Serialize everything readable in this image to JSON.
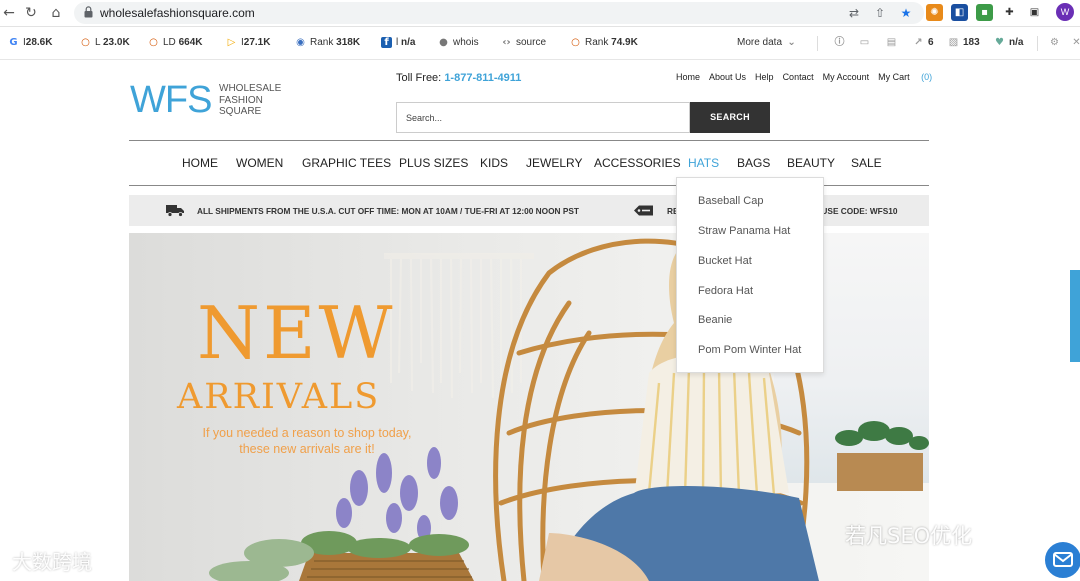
{
  "browser": {
    "url": "wholesalefashionsquare.com",
    "profile_initial": "W"
  },
  "seo_toolbar": {
    "items": [
      {
        "icon": "google-icon",
        "prefix": "I",
        "value": "28.6K"
      },
      {
        "icon": "circle-icon",
        "prefix": "L",
        "value": "23.0K"
      },
      {
        "icon": "circle-icon",
        "prefix": "LD",
        "value": "664K"
      },
      {
        "icon": "bing-icon",
        "prefix": "I",
        "value": "27.1K"
      },
      {
        "icon": "semrush-icon",
        "prefix": "Rank",
        "value": "318K"
      },
      {
        "icon": "facebook-icon",
        "prefix": "l",
        "value": "n/a"
      },
      {
        "icon": "person-icon",
        "prefix": "",
        "value": "whois"
      },
      {
        "icon": "code-icon",
        "prefix": "",
        "value": "source"
      },
      {
        "icon": "circle-icon",
        "prefix": "Rank",
        "value": "74.9K"
      }
    ],
    "more_data": "More data",
    "right_items": [
      {
        "icon": "info-icon",
        "value": ""
      },
      {
        "icon": "monitor-icon",
        "value": ""
      },
      {
        "icon": "page-icon",
        "value": ""
      },
      {
        "icon": "external-link-icon",
        "value": "6"
      },
      {
        "icon": "image-icon",
        "value": "183"
      },
      {
        "icon": "heart-icon",
        "value": "n/a"
      }
    ]
  },
  "header": {
    "logo_mark": "WFS",
    "logo_line1": "WHOLESALE",
    "logo_line2": "FASHION",
    "logo_line3": "SQUARE",
    "tollfree_label": "Toll Free:",
    "tollfree_number": "1-877-811-4911",
    "links": [
      "Home",
      "About Us",
      "Help",
      "Contact",
      "My Account",
      "My Cart"
    ],
    "cart_count": "(0)",
    "search_placeholder": "Search...",
    "search_button": "SEARCH"
  },
  "menu": {
    "items": [
      "HOME",
      "WOMEN",
      "GRAPHIC TEES",
      "PLUS SIZES",
      "KIDS",
      "JEWELRY",
      "ACCESSORIES",
      "HATS",
      "BAGS",
      "BEAUTY",
      "SALE"
    ],
    "active": "HATS"
  },
  "shipping": {
    "text": "ALL SHIPMENTS FROM THE U.S.A. CUT OFF TIME: MON AT 10AM / TUE-FRI AT 12:00 NOON PST",
    "promo": "RECEIVE 10% OFF ENTIRE WEBSITE - USE CODE: WFS10"
  },
  "dropdown": {
    "items": [
      "Baseball Cap",
      "Straw Panama Hat",
      "Bucket Hat",
      "Fedora Hat",
      "Beanie",
      "Pom Pom Winter Hat"
    ]
  },
  "hero": {
    "title": "NEW",
    "subtitle": "ARRIVALS",
    "tagline_line1": "If you needed a reason to shop today,",
    "tagline_line2": "these new arrivals are it!"
  },
  "watermarks": {
    "left": "大数跨境",
    "right": "若凡SEO优化"
  },
  "colors": {
    "accent": "#3fa3d8",
    "hero_orange": "#ef9a30"
  }
}
